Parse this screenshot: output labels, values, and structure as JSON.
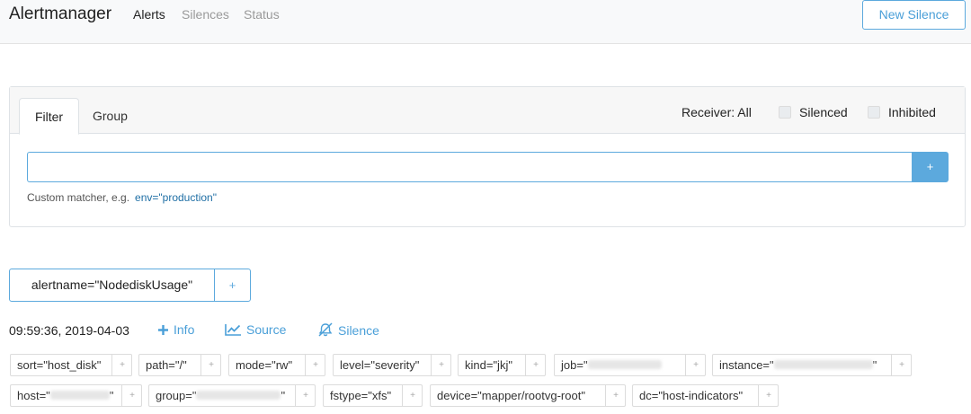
{
  "navbar": {
    "brand": "Alertmanager",
    "links": [
      {
        "label": "Alerts",
        "active": true
      },
      {
        "label": "Silences",
        "active": false
      },
      {
        "label": "Status",
        "active": false
      }
    ],
    "new_silence_label": "New Silence"
  },
  "filter_card": {
    "tabs": [
      {
        "label": "Filter",
        "active": true
      },
      {
        "label": "Group",
        "active": false
      }
    ],
    "receiver_label": "Receiver: All",
    "silenced_label": "Silenced",
    "silenced_checked": false,
    "inhibited_label": "Inhibited",
    "inhibited_checked": false,
    "input_value": "",
    "add_button_label": "+",
    "hint_prefix": "Custom matcher, e.g.",
    "hint_example": "env=\"production\""
  },
  "group": {
    "label": "alertname=\"NodediskUsage\"",
    "add_label": "+"
  },
  "alert": {
    "timestamp": "09:59:36, 2019-04-03",
    "actions": [
      {
        "label": "Info",
        "icon": "plus-icon"
      },
      {
        "label": "Source",
        "icon": "chart-line-icon"
      },
      {
        "label": "Silence",
        "icon": "bell-slash-icon"
      }
    ],
    "labels_row1": [
      {
        "text": "sort=\"host_disk\""
      },
      {
        "text": "path=\"/\""
      },
      {
        "text": "mode=\"rw\""
      },
      {
        "text": "level=\"severity\""
      },
      {
        "text": "kind=\"jkj\""
      },
      {
        "prefix": "job=\"",
        "suffix": ""
      },
      {
        "prefix": "instance=\"",
        "suffix": "\""
      }
    ],
    "labels_row2": [
      {
        "prefix": "host=\"",
        "suffix": "\""
      },
      {
        "prefix": "group=\"",
        "suffix": "\""
      },
      {
        "text": "fstype=\"xfs\""
      },
      {
        "text": "device=\"mapper/rootvg-root\""
      },
      {
        "text": "dc=\"host-indicators\""
      }
    ],
    "label_add": "+"
  },
  "colors": {
    "accent": "#5ca9dd",
    "link": "#4a9fd8",
    "navbar_bg": "#f8f9fa"
  }
}
